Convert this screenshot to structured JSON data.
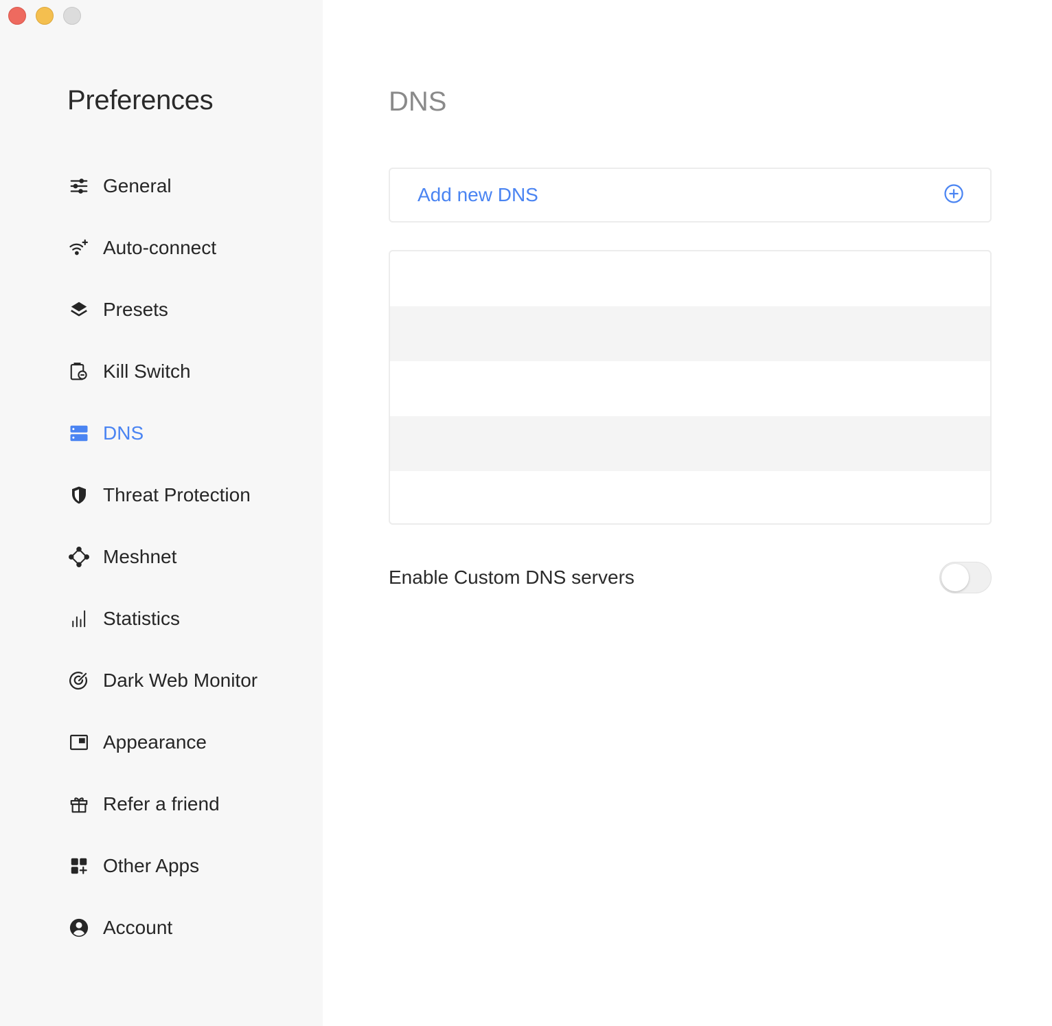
{
  "window": {
    "controls": [
      "close",
      "minimize",
      "maximize"
    ]
  },
  "sidebar": {
    "title": "Preferences",
    "items": [
      {
        "label": "General",
        "icon": "sliders-icon",
        "active": false
      },
      {
        "label": "Auto-connect",
        "icon": "wifi-sparkle-icon",
        "active": false
      },
      {
        "label": "Presets",
        "icon": "layers-icon",
        "active": false
      },
      {
        "label": "Kill Switch",
        "icon": "kill-switch-icon",
        "active": false
      },
      {
        "label": "DNS",
        "icon": "server-icon",
        "active": true
      },
      {
        "label": "Threat Protection",
        "icon": "shield-icon",
        "active": false
      },
      {
        "label": "Meshnet",
        "icon": "meshnet-icon",
        "active": false
      },
      {
        "label": "Statistics",
        "icon": "bar-chart-icon",
        "active": false
      },
      {
        "label": "Dark Web Monitor",
        "icon": "target-icon",
        "active": false
      },
      {
        "label": "Appearance",
        "icon": "window-icon",
        "active": false
      },
      {
        "label": "Refer a friend",
        "icon": "gift-icon",
        "active": false
      },
      {
        "label": "Other Apps",
        "icon": "apps-grid-icon",
        "active": false
      },
      {
        "label": "Account",
        "icon": "account-icon",
        "active": false
      }
    ]
  },
  "main": {
    "title": "DNS",
    "add_dns_label": "Add new DNS",
    "dns_entries": [
      "",
      "",
      "",
      "",
      ""
    ],
    "custom_dns_label": "Enable Custom DNS servers",
    "custom_dns_enabled": false
  },
  "colors": {
    "accent": "#4a84f2",
    "sidebar_bg": "#f7f7f7",
    "row_alt": "#f4f4f4"
  }
}
